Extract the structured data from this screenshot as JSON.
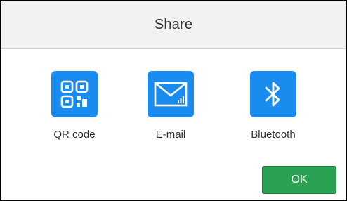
{
  "dialog": {
    "title": "Share"
  },
  "share_options": [
    {
      "label": "QR code",
      "icon": "qr-code-icon"
    },
    {
      "label": "E-mail",
      "icon": "envelope-icon"
    },
    {
      "label": "Bluetooth",
      "icon": "bluetooth-icon"
    }
  ],
  "actions": {
    "ok_label": "OK"
  },
  "colors": {
    "tile_blue": "#1a8cf0",
    "ok_green": "#2aa152",
    "title_bar_bg": "#f2f2f2"
  }
}
